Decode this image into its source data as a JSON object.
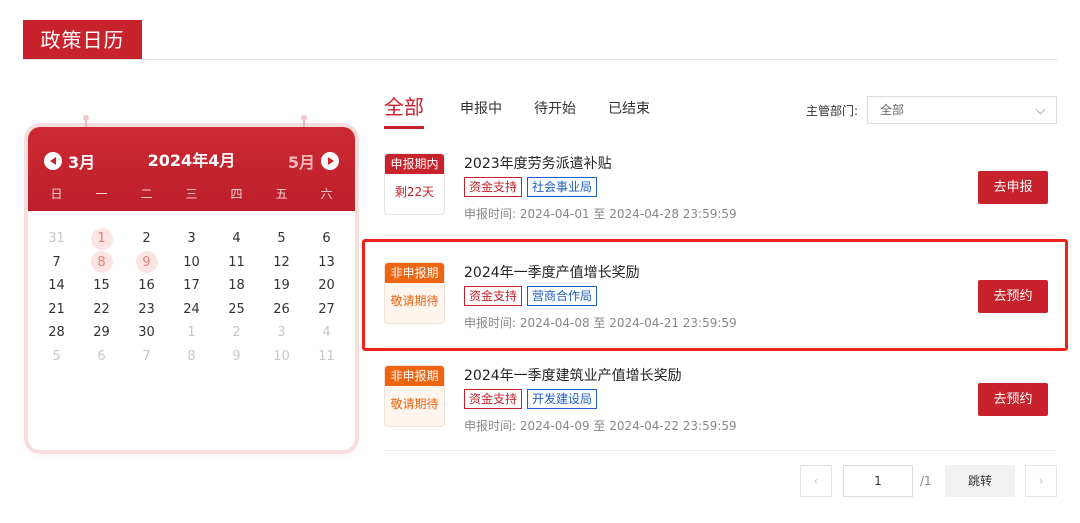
{
  "header": {
    "title": "政策日历"
  },
  "calendar": {
    "prev_month": "3月",
    "year_month": "2024年4月",
    "next_month": "5月",
    "weekdays": [
      "日",
      "一",
      "二",
      "三",
      "四",
      "五",
      "六"
    ],
    "days": [
      {
        "d": "31",
        "muted": true
      },
      {
        "d": "1",
        "marked": true
      },
      {
        "d": "2"
      },
      {
        "d": "3"
      },
      {
        "d": "4"
      },
      {
        "d": "5"
      },
      {
        "d": "6"
      },
      {
        "d": "7"
      },
      {
        "d": "8",
        "marked": true
      },
      {
        "d": "9",
        "marked": true
      },
      {
        "d": "10"
      },
      {
        "d": "11"
      },
      {
        "d": "12"
      },
      {
        "d": "13"
      },
      {
        "d": "14"
      },
      {
        "d": "15"
      },
      {
        "d": "16"
      },
      {
        "d": "17"
      },
      {
        "d": "18"
      },
      {
        "d": "19"
      },
      {
        "d": "20"
      },
      {
        "d": "21"
      },
      {
        "d": "22"
      },
      {
        "d": "23"
      },
      {
        "d": "24"
      },
      {
        "d": "25"
      },
      {
        "d": "26"
      },
      {
        "d": "27"
      },
      {
        "d": "28"
      },
      {
        "d": "29"
      },
      {
        "d": "30"
      },
      {
        "d": "1",
        "muted": true
      },
      {
        "d": "2",
        "muted": true
      },
      {
        "d": "3",
        "muted": true
      },
      {
        "d": "4",
        "muted": true
      },
      {
        "d": "5",
        "muted": true
      },
      {
        "d": "6",
        "muted": true
      },
      {
        "d": "7",
        "muted": true
      },
      {
        "d": "8",
        "muted": true
      },
      {
        "d": "9",
        "muted": true
      },
      {
        "d": "10",
        "muted": true
      },
      {
        "d": "11",
        "muted": true
      }
    ]
  },
  "tabs": [
    {
      "label": "全部",
      "active": true
    },
    {
      "label": "申报中"
    },
    {
      "label": "待开始"
    },
    {
      "label": "已结束"
    }
  ],
  "filter": {
    "label": "主管部门:",
    "value": "全部"
  },
  "policies": [
    {
      "status_tag": "申报期内",
      "status_sub": "剩22天",
      "status_color": "red",
      "title": "2023年度劳务派遣补贴",
      "badges": [
        {
          "text": "资金支持",
          "color": "red"
        },
        {
          "text": "社会事业局",
          "color": "blue"
        }
      ],
      "time": "申报时间: 2024-04-01 至 2024-04-28 23:59:59",
      "action": "去申报"
    },
    {
      "status_tag": "非申报期",
      "status_sub": "敬请期待",
      "status_color": "orange",
      "title": "2024年一季度产值增长奖励",
      "badges": [
        {
          "text": "资金支持",
          "color": "red"
        },
        {
          "text": "营商合作局",
          "color": "blue"
        }
      ],
      "time": "申报时间: 2024-04-08 至 2024-04-21 23:59:59",
      "action": "去预约"
    },
    {
      "status_tag": "非申报期",
      "status_sub": "敬请期待",
      "status_color": "orange",
      "title": "2024年一季度建筑业产值增长奖励",
      "badges": [
        {
          "text": "资金支持",
          "color": "red"
        },
        {
          "text": "开发建设局",
          "color": "blue"
        }
      ],
      "time": "申报时间: 2024-04-09 至 2024-04-22 23:59:59",
      "action": "去预约"
    }
  ],
  "pagination": {
    "prev_icon": "chevron-left-icon",
    "current": "1",
    "total": "/1",
    "jump": "跳转",
    "next_icon": "chevron-right-icon"
  },
  "colors": {
    "brand": "#c8232c",
    "orange": "#ee6410",
    "blue": "#1f5fbf",
    "highlight": "#f0231c"
  }
}
